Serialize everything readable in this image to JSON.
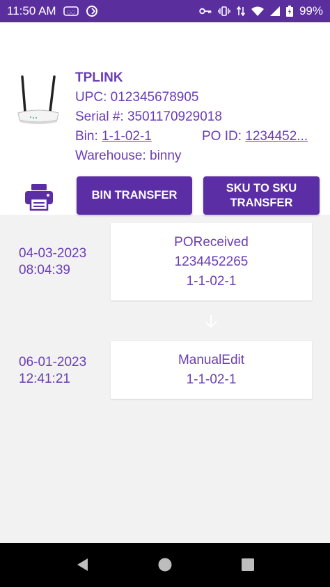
{
  "status_bar": {
    "time": "11:50 AM",
    "battery": "99%",
    "background_color": "#5b2e9e",
    "icons_left": [
      "cast-icon",
      "data-saver-icon"
    ],
    "icons_right": [
      "key-icon",
      "vibrate-icon",
      "data-arrows-icon",
      "wifi-icon",
      "signal-icon",
      "battery-charging-icon"
    ]
  },
  "product": {
    "title": "TPLINK",
    "upc": "UPC: 012345678905",
    "serial": "Serial #: 3501170929018",
    "bin_label": "Bin: ",
    "bin_value": "1-1-02-1",
    "po_label": "PO ID: ",
    "po_value": "1234452...",
    "warehouse": "Warehouse: binny",
    "image": "router-image"
  },
  "actions": {
    "print_icon": "printer-icon",
    "bin_transfer": "BIN TRANSFER",
    "sku_transfer_line1": "SKU TO SKU",
    "sku_transfer_line2": "TRANSFER"
  },
  "timeline": [
    {
      "date": "04-03-2023",
      "time": "08:04:39",
      "event": "POReceived",
      "po": "1234452265",
      "bin": "1-1-02-1"
    },
    {
      "date": "06-01-2023",
      "time": "12:41:21",
      "event": "ManualEdit",
      "bin": "1-1-02-1"
    }
  ],
  "nav": {
    "back_icon": "back-triangle-icon",
    "home_icon": "home-circle-icon",
    "recents_icon": "recents-square-icon"
  },
  "colors": {
    "accent": "#5b2ea6",
    "text_purple": "#6a3db5",
    "background": "#f2f2f2"
  }
}
